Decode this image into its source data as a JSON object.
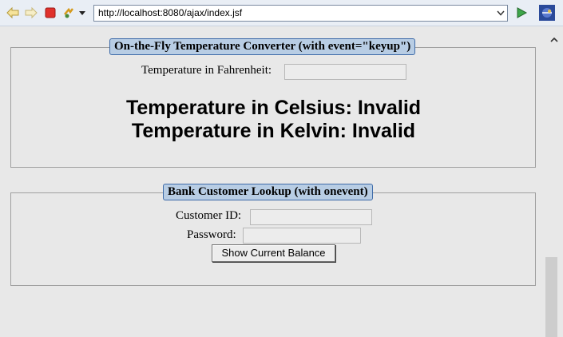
{
  "toolbar": {
    "back_icon": "back-arrow-icon",
    "forward_icon": "forward-arrow-icon",
    "stop_icon": "stop-icon",
    "refresh_icon": "refresh-icon",
    "url": "http://localhost:8080/ajax/index.jsf",
    "go_icon": "go-play-icon",
    "app_icon": "eclipse-icon"
  },
  "temperature_panel": {
    "legend": "On-the-Fly Temperature Converter (with event=\"keyup\")",
    "fahrenheit_label": "Temperature in Fahrenheit:",
    "fahrenheit_value": "",
    "celsius_text": "Temperature in Celsius: Invalid",
    "kelvin_text": "Temperature in Kelvin: Invalid"
  },
  "bank_panel": {
    "legend": "Bank Customer Lookup (with onevent)",
    "customer_id_label": "Customer ID:",
    "customer_id_value": "",
    "password_label": "Password:",
    "password_value": "",
    "button_label": "Show Current Balance"
  },
  "colors": {
    "legend_bg": "#b8cde4",
    "legend_border": "#3d6aa8",
    "page_bg": "#e8e8e8"
  }
}
